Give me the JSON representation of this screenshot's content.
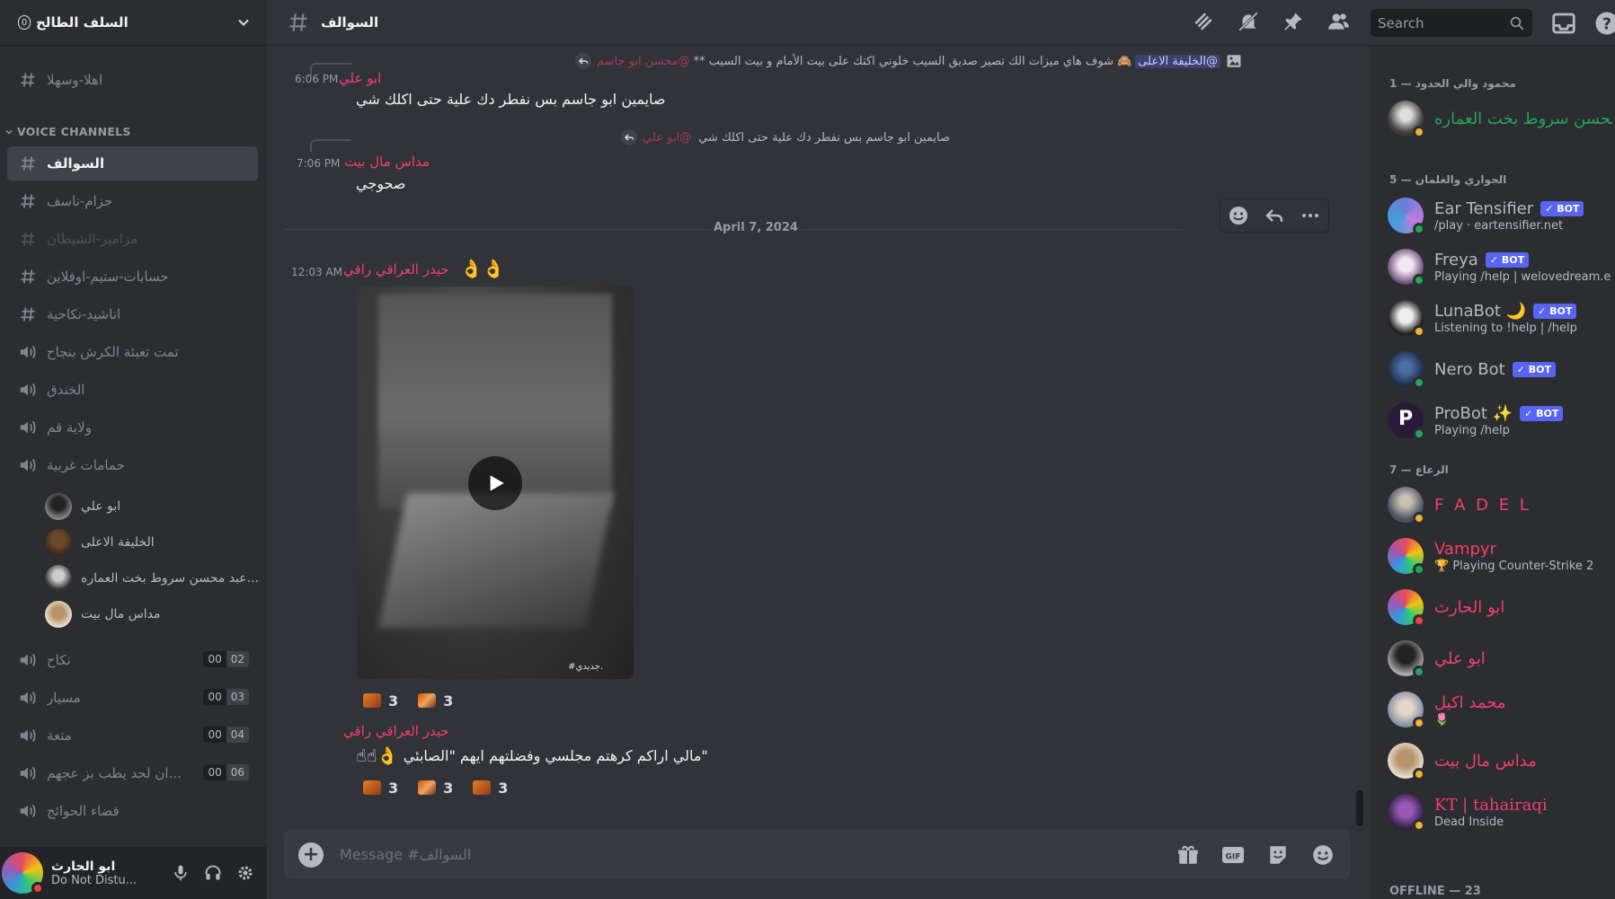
{
  "server": {
    "name": "السلف الطالح",
    "badge": "0"
  },
  "sidebar": {
    "channels_top": [
      {
        "label": "اهلا-وسهلا"
      }
    ],
    "voice_category": "VOICE CHANNELS",
    "channels": [
      {
        "label": "السوالف",
        "type": "text",
        "active": true
      },
      {
        "label": "حزام-ناسف",
        "type": "text"
      },
      {
        "label": "مزامير-الشيطان",
        "type": "text",
        "muted": true
      },
      {
        "label": "حسابات-ستيم-اوفلاين",
        "type": "text"
      },
      {
        "label": "اناشيد-نكاحية",
        "type": "text"
      },
      {
        "label": "تمت تعبئة الكرش بنجاح",
        "type": "voice"
      },
      {
        "label": "الخندق",
        "type": "voice"
      },
      {
        "label": "ولاية قم",
        "type": "voice"
      },
      {
        "label": "حمامات غربية",
        "type": "voice"
      }
    ],
    "voice_users": [
      {
        "name": "ابو علي"
      },
      {
        "name": "الخليفة الاعلى"
      },
      {
        "name": "عبد محسن سروط بخت العماره..."
      },
      {
        "name": "مداس مال بيت"
      }
    ],
    "voice_channels_with_counts": [
      {
        "label": "نكاح",
        "count_a": "00",
        "count_b": "02"
      },
      {
        "label": "مسيار",
        "count_a": "00",
        "count_b": "03"
      },
      {
        "label": "متعة",
        "count_a": "00",
        "count_b": "04"
      },
      {
        "label": "ان لحد يطب بز عجهم...",
        "count_a": "00",
        "count_b": "06"
      },
      {
        "label": "قضاء الحوائج"
      }
    ]
  },
  "user_panel": {
    "name": "ابو الحارث",
    "status": "Do Not Distu..."
  },
  "topbar": {
    "channel": "السوالف",
    "search_placeholder": "Search"
  },
  "messages": {
    "reply1": {
      "mention": "@الخليفة الاعلى",
      "author": "@محسن ابو جاسم",
      "text": "شوف هاي ميزات الك تصير صديق السيب خلوني اكتك على بيت الأمام و بيت السيب"
    },
    "msg1": {
      "time": "6:06 PM",
      "author": "ابو علي",
      "text": "صايمين ابو جاسم بس نفطر دك علية حتى اكلك شي"
    },
    "reply2": {
      "author": "@ابو علي",
      "text": "صايمين ابو جاسم بس نفطر دك علية حتى اكلك شي"
    },
    "msg2": {
      "time": "7:06 PM",
      "author": "مداس مال بيت",
      "text": "صحوجي"
    },
    "date_divider": "April 7, 2024",
    "msg3": {
      "time": "12:03 AM",
      "author": "حيدر العراقي راقي",
      "emoji": "👌👌",
      "video_watermark": "#جديدي.",
      "reactions": [
        {
          "count": "3"
        },
        {
          "count": "3"
        }
      ]
    },
    "msg4": {
      "author": "حيدر العراقي راقي",
      "text": "\"مالي اراكم كرهتم مجلسي وفضلتهم ايهم \"الصابئي",
      "emoji": "👌☝☝",
      "reactions": [
        {
          "count": "3"
        },
        {
          "count": "3"
        },
        {
          "count": "3"
        }
      ]
    }
  },
  "composer": {
    "placeholder": "Message #السوالف"
  },
  "members": {
    "categories": [
      "محمود والي الحدود — 1",
      "الجواري والغلمان — 5",
      "الرعاع — 7",
      "OFFLINE — 23"
    ],
    "list": [
      {
        "name": "محسن سروط بخت العماره...",
        "activity": "",
        "color": "#23a55a"
      },
      {
        "name": "Ear Tensifier",
        "activity": "/play · eartensifier.net",
        "bot": "BOT",
        "color": "#b5bac1"
      },
      {
        "name": "Freya",
        "activity": "Playing /help | welovedream.e",
        "bot": "BOT",
        "color": "#b5bac1"
      },
      {
        "name": "LunaBot 🌙",
        "activity": "Listening to !help | /help",
        "bot": "BOT",
        "color": "#b5bac1"
      },
      {
        "name": "Nero Bot",
        "activity": "",
        "bot": "BOT",
        "color": "#b5bac1"
      },
      {
        "name": "ProBot ✨",
        "activity": "Playing /help",
        "bot": "BOT",
        "color": "#b5bac1"
      },
      {
        "name": "F A D E L",
        "activity": "",
        "color": "#f23f6c"
      },
      {
        "name": "Vampyr",
        "activity": "Playing Counter-Strike 2",
        "color": "#f23f6c"
      },
      {
        "name": "ابو الحارث",
        "activity": "",
        "color": "#f23f6c"
      },
      {
        "name": "ابو علي",
        "activity": "",
        "color": "#f23f6c"
      },
      {
        "name": "محمد اكيل",
        "activity": "🌷",
        "color": "#f23f6c"
      },
      {
        "name": "مداس مال بيت",
        "activity": "",
        "color": "#f23f6c"
      },
      {
        "name": "KT | tahairaqi",
        "activity": "Dead Inside",
        "color": "#f23f6c"
      }
    ]
  }
}
